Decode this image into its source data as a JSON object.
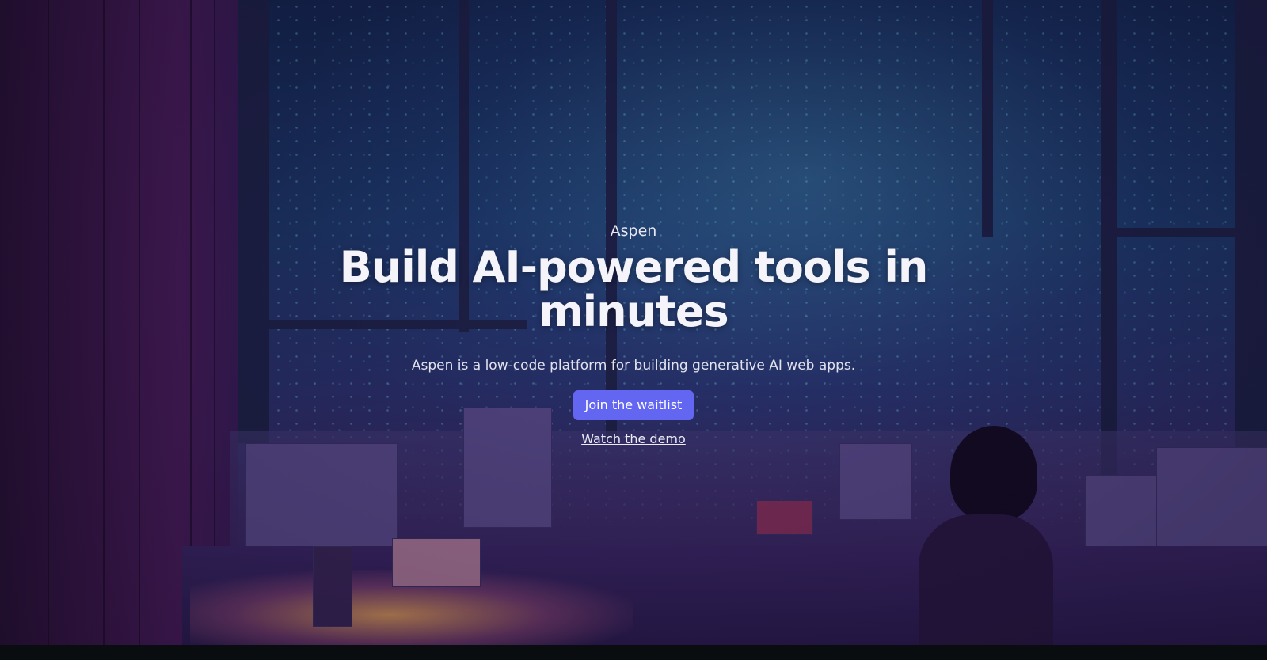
{
  "hero": {
    "brand": "Aspen",
    "headline": "Build AI-powered tools in minutes",
    "subtitle": "Aspen is a low-code platform for building generative AI web apps.",
    "cta_label": "Join the waitlist",
    "demo_link_label": "Watch the demo"
  },
  "colors": {
    "accent": "#6366f1",
    "background_dark": "#0a0d10"
  }
}
